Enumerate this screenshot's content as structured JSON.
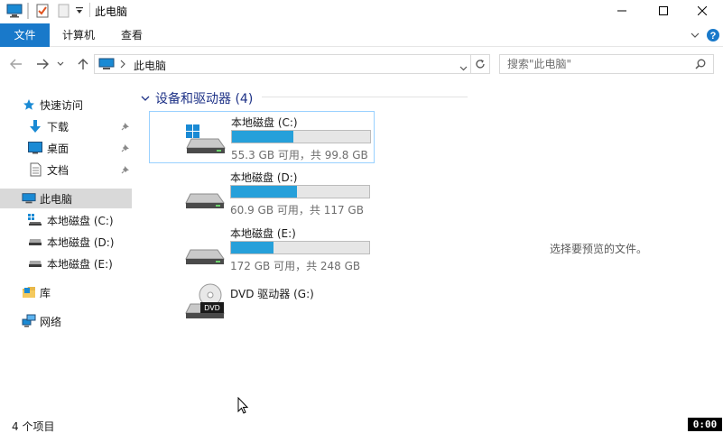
{
  "window": {
    "title": "此电脑",
    "minimize_glyph": "—",
    "maximize_glyph": "☐",
    "close_glyph": "✕"
  },
  "ribbon": {
    "tabs": [
      {
        "label": "文件",
        "active": true
      },
      {
        "label": "计算机"
      },
      {
        "label": "查看"
      }
    ]
  },
  "address": {
    "path": "此电脑",
    "search_placeholder": "搜索\"此电脑\""
  },
  "sidebar": {
    "items": [
      {
        "label": "快速访问",
        "icon": "star-icon"
      },
      {
        "label": "下载",
        "icon": "download-icon",
        "pinned": true
      },
      {
        "label": "桌面",
        "icon": "desktop-icon",
        "pinned": true
      },
      {
        "label": "文档",
        "icon": "document-icon",
        "pinned": true
      },
      {
        "label": "此电脑",
        "icon": "computer-icon",
        "selected": true
      },
      {
        "label": "本地磁盘 (C:)",
        "icon": "drive-icon"
      },
      {
        "label": "本地磁盘 (D:)",
        "icon": "drive-icon"
      },
      {
        "label": "本地磁盘 (E:)",
        "icon": "drive-icon"
      },
      {
        "label": "库",
        "icon": "library-icon"
      },
      {
        "label": "网络",
        "icon": "network-icon"
      }
    ]
  },
  "content": {
    "group_title": "设备和驱动器 (4)",
    "drives": [
      {
        "name": "本地磁盘 (C:)",
        "info": "55.3 GB 可用，共 99.8 GB",
        "used_fraction": 0.446,
        "system": true,
        "selected": true
      },
      {
        "name": "本地磁盘 (D:)",
        "info": "60.9 GB 可用，共 117 GB",
        "used_fraction": 0.479
      },
      {
        "name": "本地磁盘 (E:)",
        "info": "172 GB 可用，共 248 GB",
        "used_fraction": 0.306
      },
      {
        "name": "DVD 驱动器 (G:)",
        "dvd": true,
        "dvd_label": "DVD"
      }
    ]
  },
  "preview": {
    "message": "选择要预览的文件。"
  },
  "status": {
    "item_count": "4 个项目",
    "clock": "0:00"
  },
  "colors": {
    "accent": "#1979ca",
    "bar_fill": "#26a0da",
    "group_header": "#1e3287",
    "selection": "#d9d9d9"
  }
}
